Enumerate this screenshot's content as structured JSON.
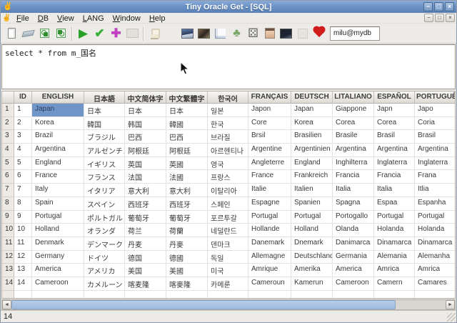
{
  "window": {
    "title": "Tiny Oracle Get - [SQL]",
    "controls": [
      {
        "name": "minimize-button",
        "glyph": "−"
      },
      {
        "name": "maximize-button",
        "glyph": "□"
      },
      {
        "name": "close-button",
        "glyph": "×"
      }
    ]
  },
  "menu": {
    "items": [
      {
        "label": "File"
      },
      {
        "label": "DB"
      },
      {
        "label": "View"
      },
      {
        "label": "LANG"
      },
      {
        "label": "Window"
      },
      {
        "label": "Help"
      }
    ],
    "child_controls": [
      {
        "name": "child-minimize-button",
        "glyph": "−"
      },
      {
        "name": "child-restore-button",
        "glyph": "□"
      },
      {
        "name": "child-close-button",
        "glyph": "×"
      }
    ]
  },
  "toolbar": {
    "connection": "milu@mydb",
    "icons": [
      {
        "name": "new-file-icon",
        "kind": "page"
      },
      {
        "name": "eraser-icon",
        "kind": "eraser"
      },
      {
        "name": "export-table-icon",
        "kind": "export"
      },
      {
        "name": "import-table-icon",
        "kind": "import"
      },
      {
        "name": "run-query-icon",
        "kind": "play"
      },
      {
        "name": "commit-check-icon",
        "kind": "check"
      },
      {
        "name": "add-plus-icon",
        "kind": "plus"
      },
      {
        "name": "image-disabled-icon",
        "kind": "imgdis"
      },
      {
        "name": "chair-icon",
        "kind": "chair"
      },
      {
        "name": "text-i-icon",
        "kind": "texti"
      },
      {
        "name": "photo-mountain-icon",
        "kind": "photo1"
      },
      {
        "name": "photo-portrait-icon",
        "kind": "photo2"
      },
      {
        "name": "chart-axes-icon",
        "kind": "chart"
      },
      {
        "name": "tree-icon",
        "kind": "tree"
      },
      {
        "name": "dice-icon",
        "kind": "dice"
      },
      {
        "name": "face-photo-icon",
        "kind": "face"
      },
      {
        "name": "photo-dark-icon",
        "kind": "photodark"
      },
      {
        "name": "disabled-blank-icon",
        "kind": "dis2"
      },
      {
        "name": "heart-icon",
        "kind": "heart"
      }
    ]
  },
  "editor": {
    "sql": "select * from m_国名"
  },
  "grid": {
    "columns": [
      "ID",
      "ENGLISH",
      "日本語",
      "中文简体字",
      "中文繁體字",
      "한국어",
      "FRANÇAIS",
      "DEUTSCH",
      "LITALIANO",
      "ESPAÑOL",
      "PORTUGUÊS"
    ],
    "rows": [
      {
        "n": "1",
        "cells": [
          "1",
          "Japan",
          "日本",
          "日本",
          "日本",
          "일본",
          "Japon",
          "Japan",
          "Giappone",
          "Japn",
          "Japo"
        ]
      },
      {
        "n": "2",
        "cells": [
          "2",
          "Korea",
          "韓国",
          "韩国",
          "韓國",
          "한국",
          "Core",
          "Korea",
          "Corea",
          "Corea",
          "Coria"
        ]
      },
      {
        "n": "3",
        "cells": [
          "3",
          "Brazil",
          "ブラジル",
          "巴西",
          "巴西",
          "브라질",
          "Brsil",
          "Brasilien",
          "Brasile",
          "Brasil",
          "Brasil"
        ]
      },
      {
        "n": "4",
        "cells": [
          "4",
          "Argentina",
          "アルゼンチン",
          "阿根廷",
          "阿根廷",
          "아르헨티나",
          "Argentine",
          "Argentinien",
          "Argentina",
          "Argentina",
          "Argentina"
        ]
      },
      {
        "n": "5",
        "cells": [
          "5",
          "England",
          "イギリス",
          "英国",
          "英國",
          "영국",
          "Angleterre",
          "England",
          "Inghilterra",
          "Inglaterra",
          "Inglaterra"
        ]
      },
      {
        "n": "6",
        "cells": [
          "6",
          "France",
          "フランス",
          "法国",
          "法國",
          "프랑스",
          "France",
          "Frankreich",
          "Francia",
          "Francia",
          "Frana"
        ]
      },
      {
        "n": "7",
        "cells": [
          "7",
          "Italy",
          "イタリア",
          "意大利",
          "意大利",
          "이탈리아",
          "Italie",
          "Italien",
          "Italia",
          "Italia",
          "Itlia"
        ]
      },
      {
        "n": "8",
        "cells": [
          "8",
          "Spain",
          "スペイン",
          "西班牙",
          "西班牙",
          "스페인",
          "Espagne",
          "Spanien",
          "Spagna",
          "Espaa",
          "Espanha"
        ]
      },
      {
        "n": "9",
        "cells": [
          "9",
          "Portugal",
          "ポルトガル",
          "葡萄牙",
          "葡萄牙",
          "포르투갈",
          "Portugal",
          "Portugal",
          "Portogallo",
          "Portugal",
          "Portugal"
        ]
      },
      {
        "n": "10",
        "cells": [
          "10",
          "Holland",
          "オランダ",
          "荷兰",
          "荷蘭",
          "네덜란드",
          "Hollande",
          "Holland",
          "Olanda",
          "Holanda",
          "Holanda"
        ]
      },
      {
        "n": "11",
        "cells": [
          "11",
          "Denmark",
          "デンマーク",
          "丹麦",
          "丹麥",
          "덴마크",
          "Danemark",
          "Dnemark",
          "Danimarca",
          "Dinamarca",
          "Dinamarca"
        ]
      },
      {
        "n": "12",
        "cells": [
          "12",
          "Germany",
          "ドイツ",
          "德国",
          "德國",
          "독일",
          "Allemagne",
          "Deutschland",
          "Germania",
          "Alemania",
          "Alemanha"
        ]
      },
      {
        "n": "13",
        "cells": [
          "13",
          "America",
          "アメリカ",
          "美国",
          "美國",
          "미국",
          "Amrique",
          "Amerika",
          "America",
          "Amrica",
          "Amrica"
        ]
      },
      {
        "n": "14",
        "cells": [
          "14",
          "Cameroon",
          "カメルーン",
          "喀麦隆",
          "喀麥隆",
          "카메룬",
          "Cameroun",
          "Kamerun",
          "Cameroon",
          "Camern",
          "Camares"
        ]
      }
    ],
    "selected": {
      "row": "1",
      "column": "ENGLISH",
      "value": "Japan"
    }
  },
  "status": {
    "row_count": "14"
  },
  "colors": {
    "titlebar_top": "#8aabd8",
    "titlebar_bottom": "#5b82b6",
    "selection_blue": "#7095c8",
    "run_green": "#28a028",
    "plus_magenta": "#c23fc2",
    "heart_red": "#d11c1c",
    "scroll_thumb": "#a8c4e3"
  }
}
